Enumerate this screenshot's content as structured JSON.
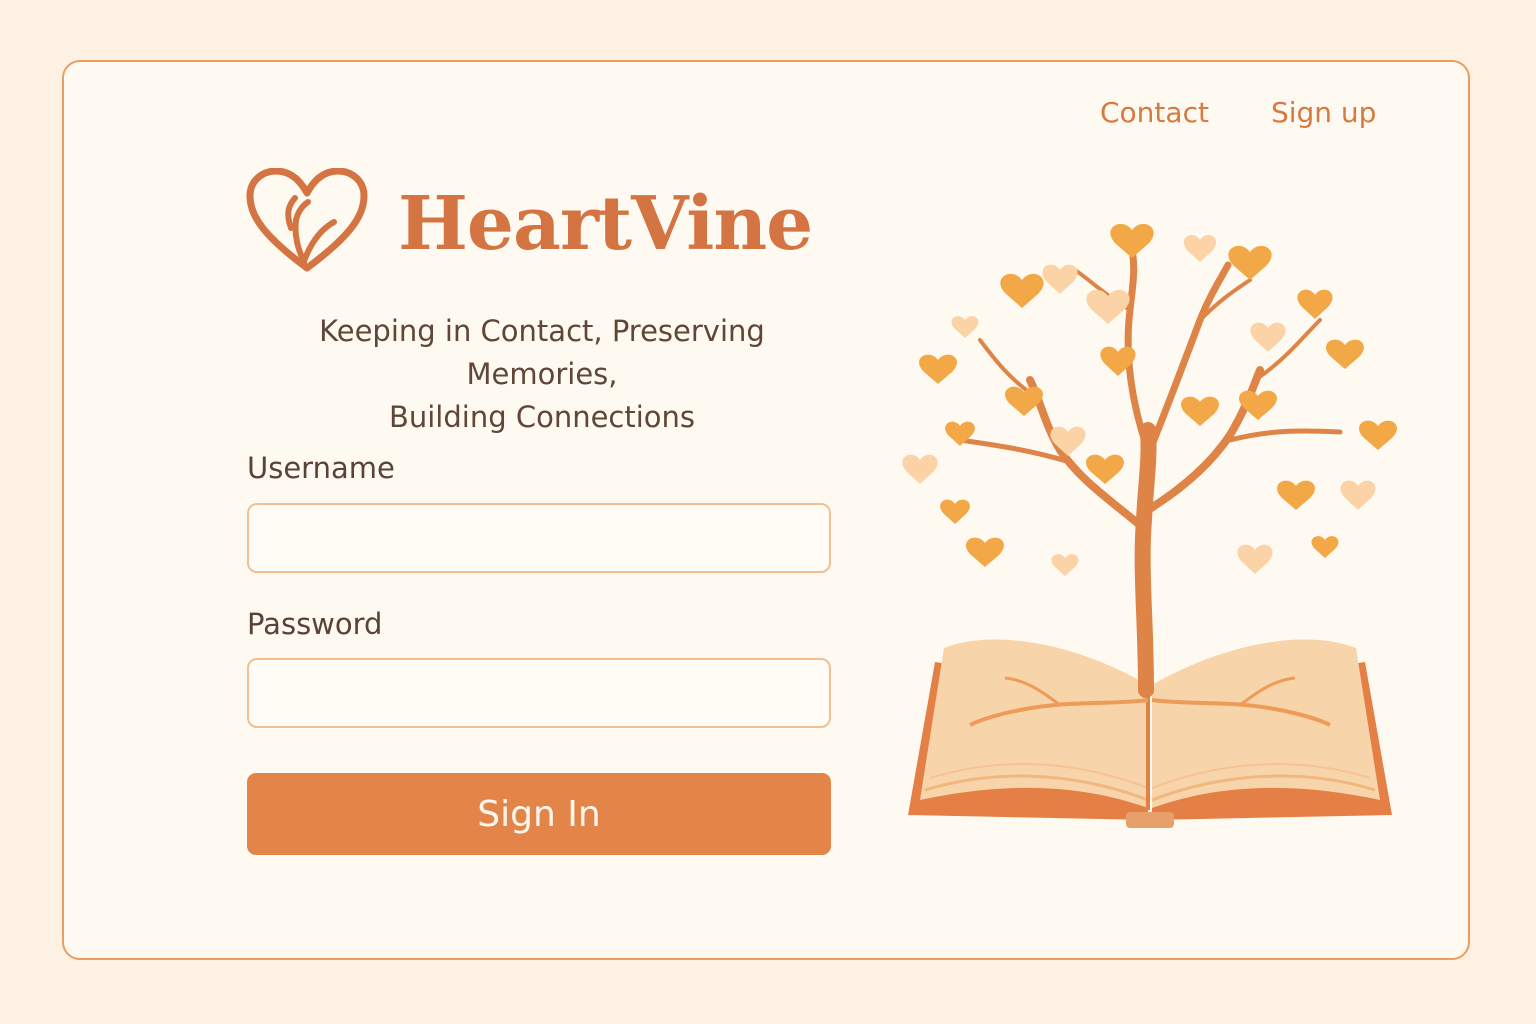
{
  "nav": {
    "contact": "Contact",
    "signup": "Sign up"
  },
  "brand": {
    "name": "HeartVine",
    "logo_icon": "heart-leaf-icon"
  },
  "tagline": {
    "line1": "Keeping in Contact, Preserving Memories,",
    "line2": "Building Connections"
  },
  "form": {
    "username_label": "Username",
    "username_value": "",
    "password_label": "Password",
    "password_value": "",
    "submit_label": "Sign In"
  },
  "illustration": {
    "name": "tree-growing-from-open-book"
  },
  "colors": {
    "accent": "#e38549",
    "brand": "#d47443",
    "field_border": "#f2bf91",
    "card_border": "#ec9c5f",
    "background": "#fdf1e4",
    "card_background": "#fffaf1"
  }
}
